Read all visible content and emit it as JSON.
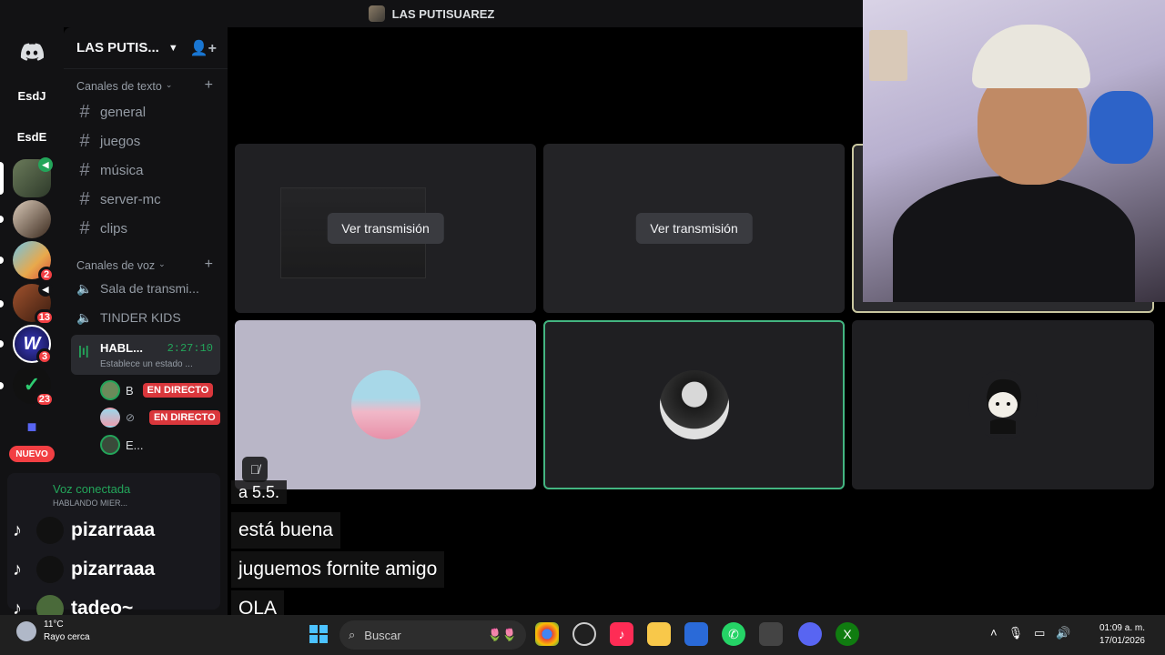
{
  "window": {
    "title": "LAS PUTISUAREZ"
  },
  "guilds": {
    "items": [
      {
        "label": "EsdJ"
      },
      {
        "label": "EsdE"
      },
      {
        "badge": ""
      },
      {
        "badge": ""
      },
      {
        "badge": "2"
      },
      {
        "badge": "13"
      },
      {
        "badge": "3"
      },
      {
        "badge": "23"
      }
    ],
    "new_label": "NUEVO"
  },
  "server": {
    "name": "LAS PUTIS...",
    "text_category": "Canales de texto",
    "voice_category": "Canales de voz"
  },
  "text_channels": [
    "general",
    "juegos",
    "música",
    "server-mc",
    "clips"
  ],
  "voice_channels": [
    "Sala de transmi...",
    "TINDER KIDS"
  ],
  "active_voice": {
    "name": "HABL...",
    "time": "2:27:10",
    "status": "Establece un estado ..."
  },
  "voice_users": [
    {
      "name": "B",
      "live": "EN DIRECTO"
    },
    {
      "name": "",
      "live": "EN DIRECTO"
    },
    {
      "name": "E..."
    }
  ],
  "voice_panel": {
    "connected": "Voz conectada",
    "channel": "HABLANDO MIER..."
  },
  "tiles": [
    {
      "button": "Ver transmisión"
    },
    {
      "button": "Ver transmisión"
    }
  ],
  "chat": [
    {
      "user": "pizarraaa",
      "message": "está buena"
    },
    {
      "user": "pizarraaa",
      "message": "juguemos fornite amigo"
    },
    {
      "user": "tadeo~",
      "message": "OLA"
    }
  ],
  "chat_partial": "a 5.5.",
  "taskbar": {
    "weather_temp": "11°C",
    "weather_desc": "Rayo cerca",
    "search_placeholder": "Buscar",
    "time": "01:09 a. m.",
    "date": "17/01/2026"
  },
  "colors": {
    "accent_green": "#23a55a",
    "live_red": "#da373c",
    "badge_red": "#f23f43"
  }
}
